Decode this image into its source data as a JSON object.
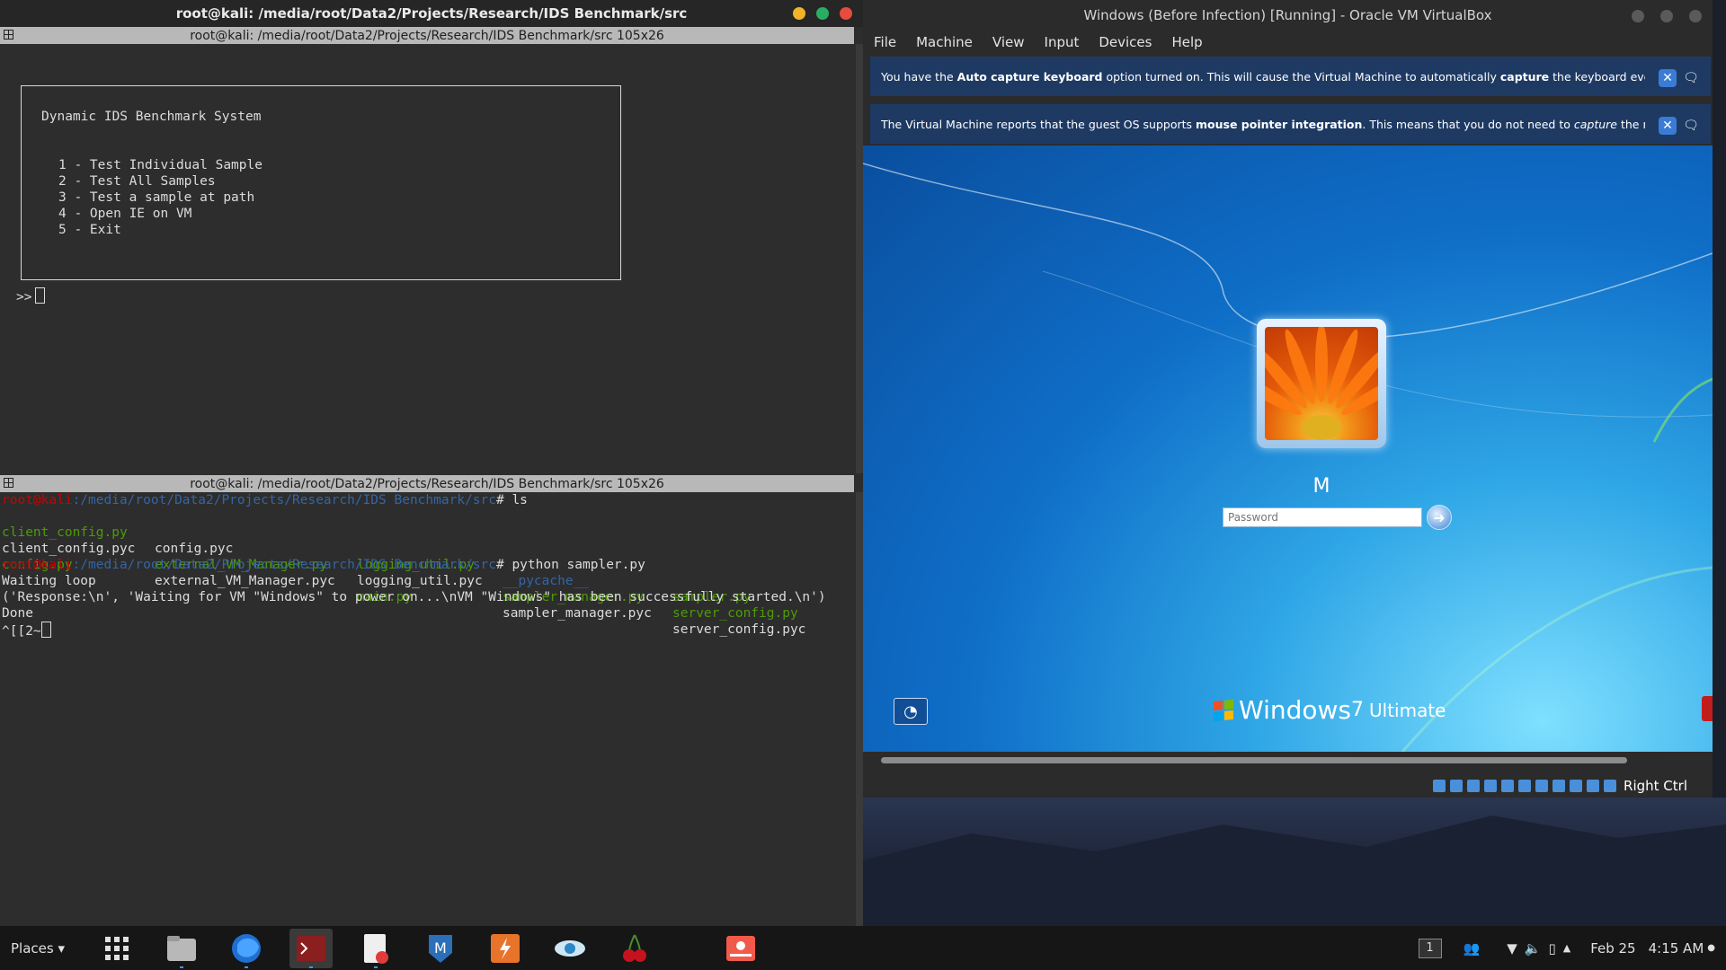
{
  "terminal": {
    "window_title": "root@kali: /media/root/Data2/Projects/Research/IDS Benchmark/src",
    "top_pane_header": "root@kali: /media/root/Data2/Projects/Research/IDS Benchmark/src 105x26",
    "bottom_pane_header": "root@kali: /media/root/Data2/Projects/Research/IDS Benchmark/src 105x26",
    "menu_title": "Dynamic IDS Benchmark System",
    "menu_options": [
      "1 - Test Individual Sample",
      "2 - Test All Samples",
      "3 - Test a sample at path",
      "4 - Open IE on VM",
      "5 - Exit"
    ],
    "prompt": ">>",
    "prompt_user": "root@kali",
    "prompt_path": ":/media/root/Data2/Projects/Research/IDS Benchmark/src",
    "cmd_ls": "# ls",
    "ls_files": [
      [
        "client_config.py",
        "config.pyc",
        "logging_util.py",
        "__pycache__",
        "sampler.py"
      ],
      [
        "client_config.pyc",
        "external_VM_Manager.py",
        "logging_util.pyc",
        "sampler_manager.py",
        "server_config.py"
      ],
      [
        "config.py",
        "external_VM_Manager.pyc",
        "main.py",
        "sampler_manager.pyc",
        "server_config.pyc"
      ]
    ],
    "cmd_python": "# python sampler.py",
    "output_lines": [
      "Waiting loop",
      "('Response:\\n', 'Waiting for VM \"Windows\" to power on...\\nVM \"Windows\" has been successfully started.\\n')",
      "Done",
      "^[[2~"
    ]
  },
  "vbox": {
    "window_title": "Windows (Before Infection) [Running] - Oracle VM VirtualBox",
    "menu": [
      "File",
      "Machine",
      "View",
      "Input",
      "Devices",
      "Help"
    ],
    "notice1": {
      "a": "You have the ",
      "b": "Auto capture keyboard",
      "c": " option turned on. This will cause the Virtual Machine to automatically ",
      "d": "capture",
      "e": " the keyboard every time the VM"
    },
    "notice2": {
      "a": "The Virtual Machine reports that the guest OS supports ",
      "b": "mouse pointer integration",
      "c": ". This means that you do not need to ",
      "d": "capture",
      "e": " the mouse pointer to"
    },
    "guest": {
      "username": "M",
      "password_placeholder": "Password",
      "brand_windows": "Windows",
      "brand_version": "7",
      "brand_edition": "Ultimate"
    },
    "host_key": "Right Ctrl"
  },
  "taskbar": {
    "places": "Places ▾",
    "apps": [
      "app-grid",
      "files",
      "firefox",
      "terminal",
      "text-editor",
      "metasploit",
      "burpsuite",
      "eye-app",
      "cherrytree",
      "screenshot-tool"
    ],
    "workspace": "1",
    "date": "Feb 25",
    "time": "4:15 AM"
  }
}
